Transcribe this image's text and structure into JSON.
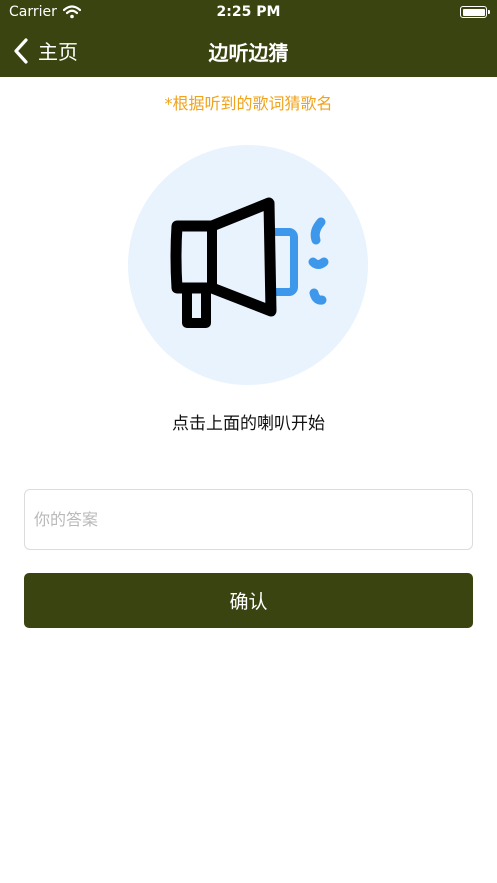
{
  "status_bar": {
    "carrier": "Carrier",
    "time": "2:25 PM"
  },
  "nav": {
    "back_label": "主页",
    "title": "边听边猜"
  },
  "hint": "*根据听到的歌词猜歌名",
  "speaker": {
    "icon": "megaphone-icon",
    "caption": "点击上面的喇叭开始"
  },
  "answer_field": {
    "placeholder": "你的答案",
    "value": ""
  },
  "confirm_button": {
    "label": "确认"
  },
  "colors": {
    "header": "#3a4410",
    "hint": "#f0a31c",
    "circle": "#e8f3fd",
    "sound": "#3d97ea"
  }
}
